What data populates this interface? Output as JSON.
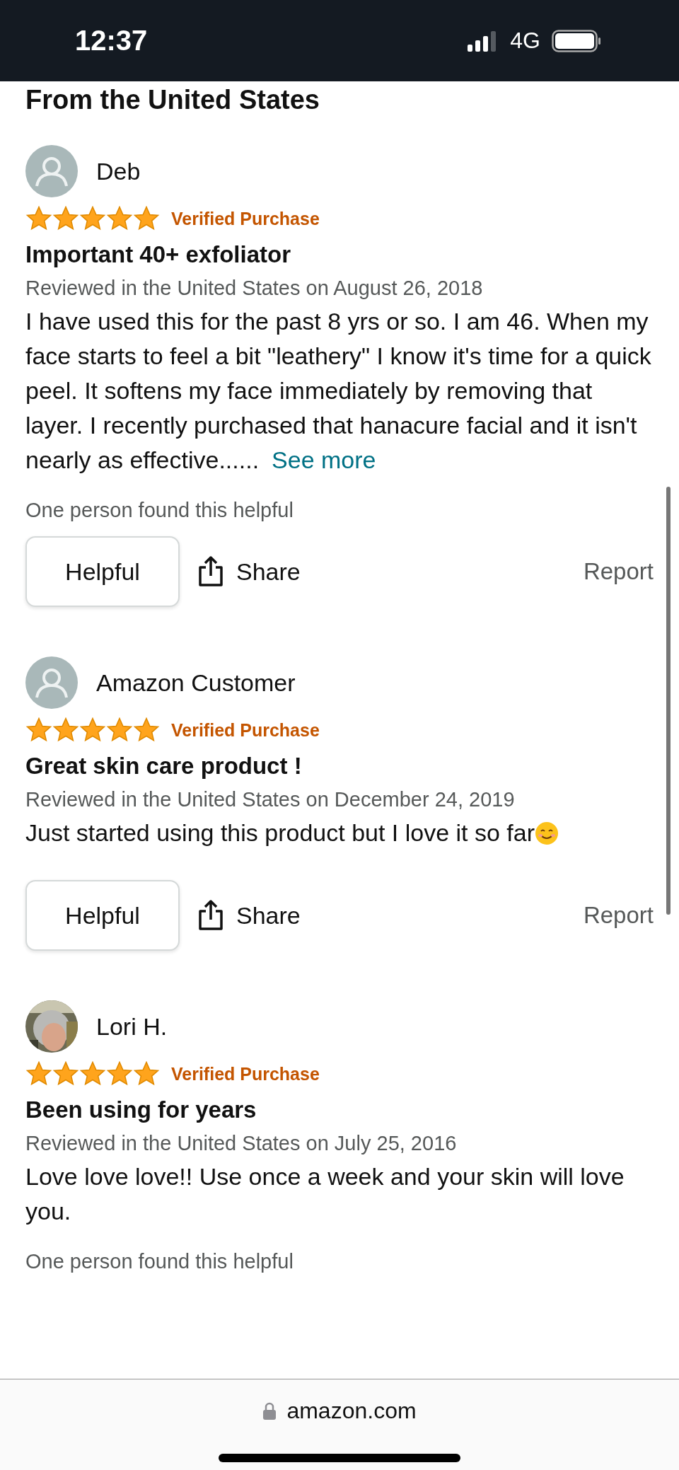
{
  "status_bar": {
    "time": "12:37",
    "network": "4G"
  },
  "section_heading": "From the United States",
  "reviews": [
    {
      "author": "Deb",
      "avatar": {
        "kind": "default"
      },
      "stars": 5,
      "badge": "Verified Purchase",
      "title": "Important 40+ exfoliator",
      "date": "Reviewed in the United States on August 26, 2018",
      "body": "I have used this for the past 8 yrs or so. I am 46. When my face starts to feel a bit \"leathery\" I know it's time for a quick peel. It softens my face immediately by removing that layer. I recently purchased that hanacure facial and it isn't nearly as effective......",
      "see_more": "See more",
      "helpful_count": "One person found this helpful",
      "actions": {
        "helpful": "Helpful",
        "share": "Share",
        "report": "Report"
      }
    },
    {
      "author": "Amazon Customer",
      "avatar": {
        "kind": "default"
      },
      "stars": 5,
      "badge": "Verified Purchase",
      "title": "Great skin care product !",
      "date": "Reviewed in the United States on December 24, 2019",
      "body": "Just started using this product but I love it so far",
      "emoji": {
        "kind": "smile"
      },
      "actions": {
        "helpful": "Helpful",
        "share": "Share",
        "report": "Report"
      }
    },
    {
      "author": "Lori H.",
      "stars": 5,
      "badge": "Verified Purchase",
      "title": "Been using for years",
      "date": "Reviewed in the United States on July 25, 2016",
      "body": "Love love love!! Use once a week and your skin will love you.",
      "helpful_count": "One person found this helpful"
    }
  ],
  "address_bar": {
    "domain": "amazon.com"
  }
}
